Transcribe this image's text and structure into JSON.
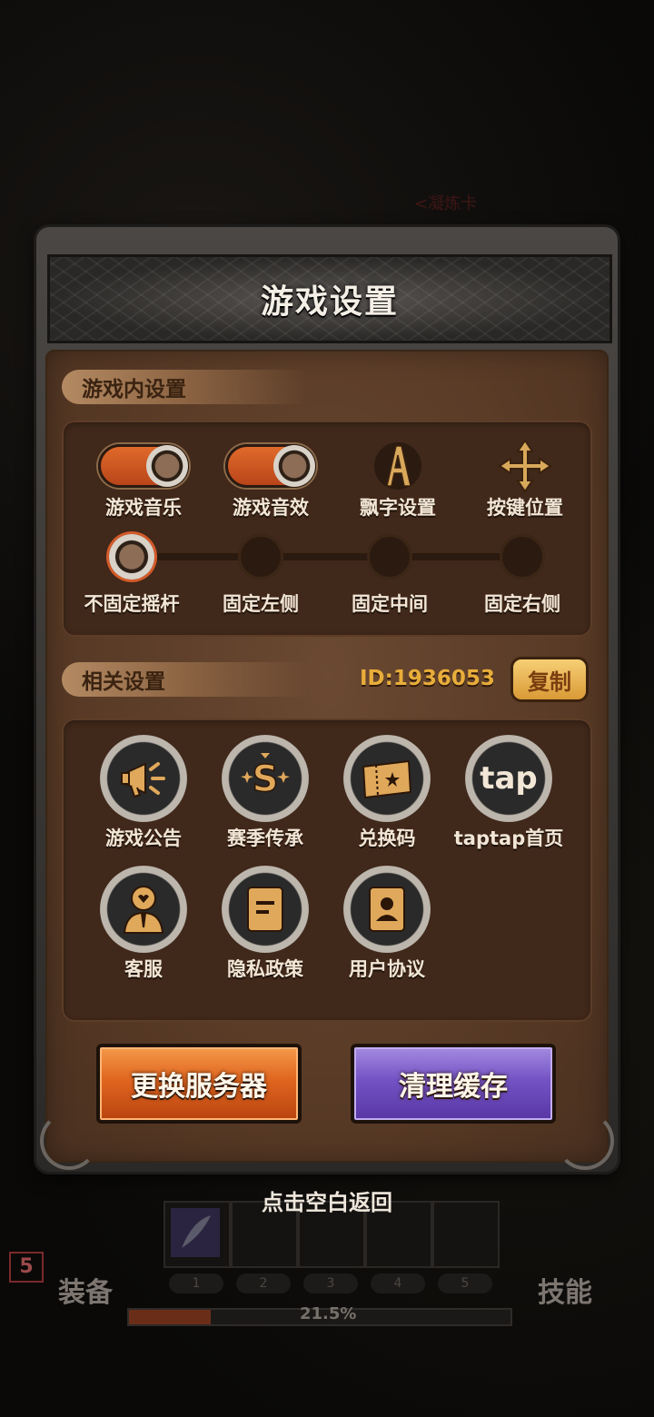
{
  "dialog": {
    "title": "游戏设置",
    "in_game_section": {
      "label": "游戏内设置",
      "controls": [
        {
          "label": "游戏音乐",
          "icon": "toggle-switch",
          "state": "on"
        },
        {
          "label": "游戏音效",
          "icon": "toggle-switch",
          "state": "on"
        },
        {
          "label": "飘字设置",
          "icon": "letter-a-icon"
        },
        {
          "label": "按键位置",
          "icon": "move-arrows-icon"
        }
      ],
      "joystick_options": [
        "不固定摇杆",
        "固定左侧",
        "固定中间",
        "固定右侧"
      ],
      "joystick_selected": "不固定摇杆"
    },
    "related_section": {
      "label": "相关设置",
      "id_text": "ID:1936053",
      "copy_label": "复制",
      "items": [
        {
          "label": "游戏公告",
          "icon": "megaphone-icon"
        },
        {
          "label": "赛季传承",
          "icon": "season-s-icon"
        },
        {
          "label": "兑换码",
          "icon": "ticket-icon"
        },
        {
          "label": "taptap首页",
          "icon": "tap-logo",
          "icon_text": "tap"
        },
        {
          "label": "客服",
          "icon": "support-agent-icon"
        },
        {
          "label": "隐私政策",
          "icon": "document-icon"
        },
        {
          "label": "用户协议",
          "icon": "user-card-icon"
        }
      ]
    },
    "change_server_label": "更换服务器",
    "clear_cache_label": "清理缓存"
  },
  "hint": "点击空白返回",
  "hud": {
    "background_tag": "<凝炼卡",
    "equip_label": "装备",
    "skill_label": "技能",
    "level": "5",
    "slot_numbers": [
      "1",
      "2",
      "3",
      "4",
      "5"
    ],
    "progress_text": "21.5%",
    "progress_fraction": 0.215
  },
  "colors": {
    "accent_orange": "#e0651f",
    "accent_purple": "#7353c4",
    "id_gold": "#e8ad3a",
    "panel_brown": "#553824"
  }
}
